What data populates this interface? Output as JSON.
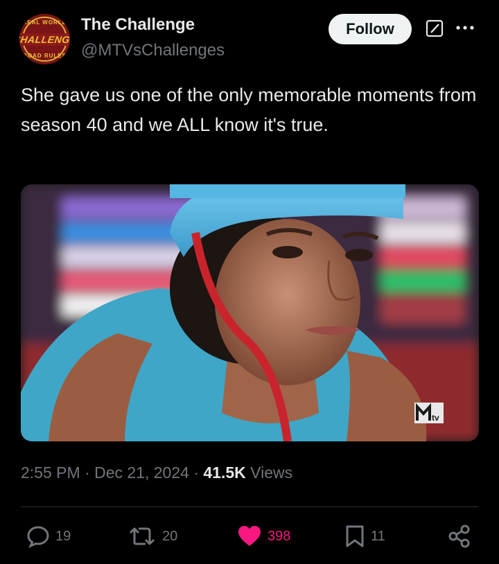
{
  "account": {
    "name": "The Challenge",
    "handle": "@MTVsChallenges",
    "avatar_text": "CHALLENGE",
    "avatar_arc_top": "REAL WORLD",
    "avatar_arc_bottom": "ROAD RULES"
  },
  "header": {
    "follow_label": "Follow"
  },
  "tweet": {
    "text": "She gave us one of the only memorable moments from season 40 and we ALL know it's true."
  },
  "media": {
    "watermark": "MTV"
  },
  "meta": {
    "time": "2:55 PM",
    "separator": " · ",
    "date": "Dec 21, 2024",
    "views_count": "41.5K",
    "views_label": " Views"
  },
  "actions": {
    "replies": "19",
    "reposts": "20",
    "likes": "398",
    "bookmarks": "11"
  },
  "colors": {
    "background": "#000000",
    "text": "#e7e9ea",
    "muted": "#71767b",
    "like": "#f91880",
    "divider": "#2f3336"
  }
}
